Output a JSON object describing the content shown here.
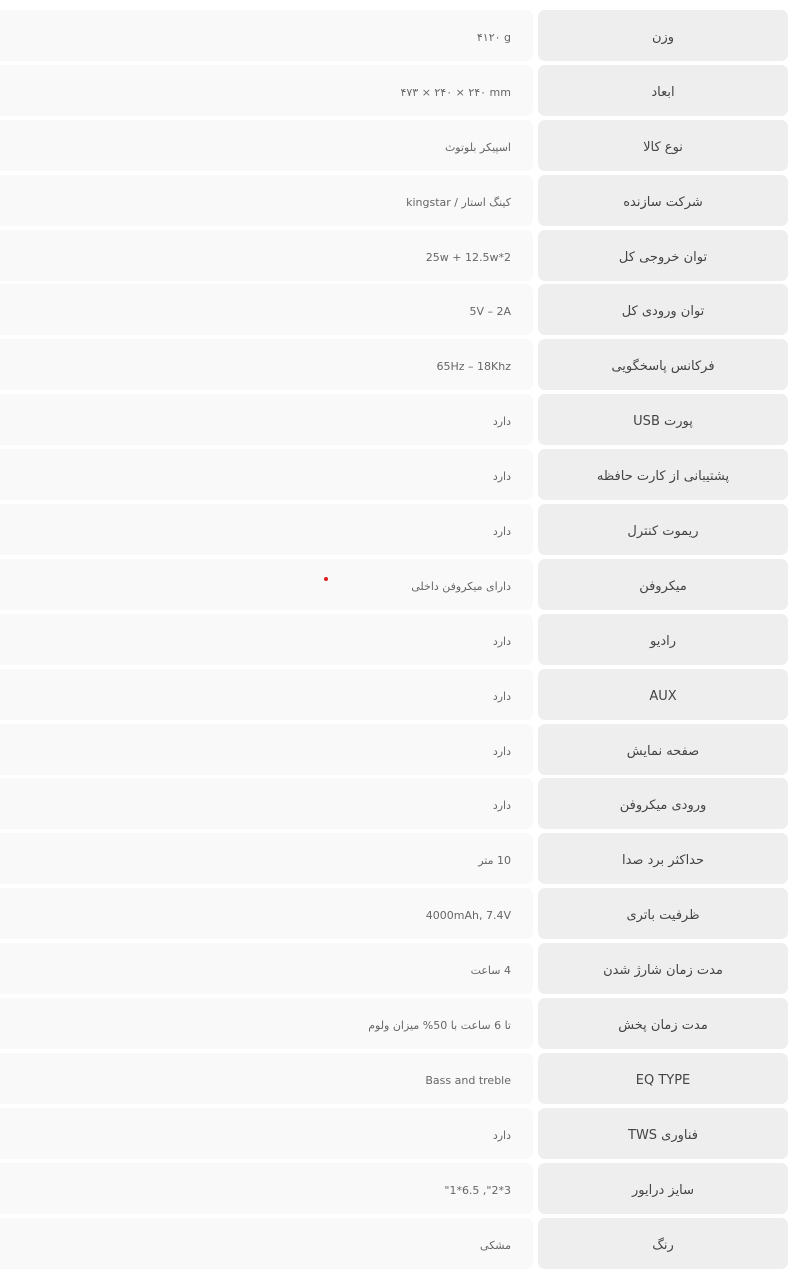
{
  "specs": {
    "rows": [
      {
        "label": "وزن",
        "value": "۴۱۲۰ g"
      },
      {
        "label": "ابعاد",
        "value": "۴۷۳ × ۲۴۰ × ۲۴۰ mm"
      },
      {
        "label": "نوع کالا",
        "value": "اسپیکر بلوتوث"
      },
      {
        "label": "شرکت سازنده",
        "value": "کینگ استار / kingstar"
      },
      {
        "label": "توان خروجی کل",
        "value": "25w + 12.5w*2"
      },
      {
        "label": "توان ورودی کل",
        "value": "5V – 2A"
      },
      {
        "label": "فرکانس پاسخگویی",
        "value": "65Hz – 18Khz"
      },
      {
        "label": "پورت USB",
        "value": "دارد"
      },
      {
        "label": "پشتیبانی از کارت حافظه",
        "value": "دارد"
      },
      {
        "label": "ریموت کنترل",
        "value": "دارد"
      },
      {
        "label": "میکروفن",
        "value": "دارای میکروفن داخلی"
      },
      {
        "label": "رادیو",
        "value": "دارد"
      },
      {
        "label": "AUX",
        "value": "دارد"
      },
      {
        "label": "صفحه نمایش",
        "value": "دارد"
      },
      {
        "label": "ورودی میکروفن",
        "value": "دارد"
      },
      {
        "label": "حداکثر برد صدا",
        "value": "10 متر"
      },
      {
        "label": "ظرفیت باتری",
        "value": "4000mAh, 7.4V"
      },
      {
        "label": "مدت زمان شارژ شدن",
        "value": "4 ساعت"
      },
      {
        "label": "مدت زمان پخش",
        "value": "تا 6 ساعت با 50% میزان ولوم"
      },
      {
        "label": "EQ TYPE",
        "value": "Bass and treble"
      },
      {
        "label": "فناوری TWS",
        "value": "دارد"
      },
      {
        "label": "سایز درایور",
        "value": "3*2\", 6.5*1\""
      },
      {
        "label": "رنگ",
        "value": "مشکی"
      }
    ]
  },
  "colors": {
    "label_bg": "#eeeeee",
    "value_bg": "#f9f9f9",
    "label_text": "#444444",
    "value_text": "#666666",
    "marker": "#e02020"
  }
}
